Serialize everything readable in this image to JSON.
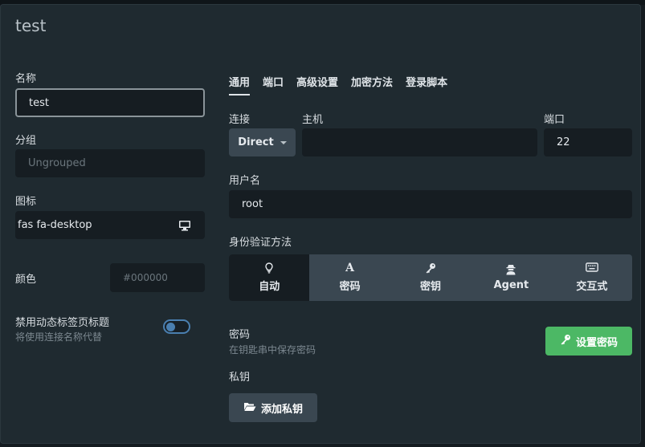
{
  "dialog": {
    "title": "test"
  },
  "left": {
    "name_label": "名称",
    "name_value": "test",
    "group_label": "分组",
    "group_placeholder": "Ungrouped",
    "icon_label": "图标",
    "icon_value": "fas fa-desktop",
    "color_label": "颜色",
    "color_placeholder": "#000000",
    "dynamic_title_label": "禁用动态标签页标题",
    "dynamic_title_sub": "将使用连接名称代替",
    "dynamic_title_enabled": false
  },
  "tabs": [
    {
      "label": "通用",
      "active": true
    },
    {
      "label": "端口",
      "active": false
    },
    {
      "label": "高级设置",
      "active": false
    },
    {
      "label": "加密方法",
      "active": false
    },
    {
      "label": "登录脚本",
      "active": false
    }
  ],
  "general": {
    "connection_label": "连接",
    "connection_value": "Direct",
    "host_label": "主机",
    "host_value": "",
    "port_label": "端口",
    "port_value": "22",
    "username_label": "用户名",
    "username_value": "root",
    "auth_label": "身份验证方法",
    "auth_methods": [
      {
        "label": "自动",
        "icon": "lightbulb-icon",
        "active": true
      },
      {
        "label": "密码",
        "icon": "font-icon",
        "active": false
      },
      {
        "label": "密钥",
        "icon": "key-icon",
        "active": false
      },
      {
        "label": "Agent",
        "icon": "user-secret-icon",
        "active": false
      },
      {
        "label": "交互式",
        "icon": "keyboard-icon",
        "active": false
      }
    ],
    "password_label": "密码",
    "password_sub": "在钥匙串中保存密码",
    "set_password_button": "设置密码",
    "private_key_label": "私钥",
    "add_key_button": "添加私钥"
  },
  "colors": {
    "accent_green": "#4cb865",
    "toggle_blue": "#4a7fb0",
    "dialog_bg": "#1f2a30",
    "input_bg": "#161d22"
  }
}
